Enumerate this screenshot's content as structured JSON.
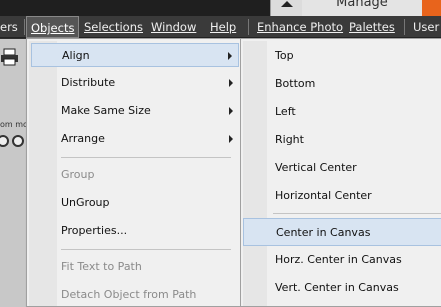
{
  "window": {
    "manage_tab": "Manage"
  },
  "menubar": {
    "items": [
      {
        "label": "ers"
      },
      {
        "label": "Objects"
      },
      {
        "label": "Selections"
      },
      {
        "label": "Window"
      },
      {
        "label": "Help"
      },
      {
        "label": "Enhance Photo"
      },
      {
        "label": "Palettes"
      },
      {
        "label": "User I"
      }
    ]
  },
  "toolbar": {
    "zoom_label": "om mo"
  },
  "objects_menu": {
    "items": [
      {
        "label": "Align",
        "submenu": true,
        "enabled": true,
        "highlighted": true
      },
      {
        "label": "Distribute",
        "submenu": true,
        "enabled": true
      },
      {
        "label": "Make Same Size",
        "submenu": true,
        "enabled": true
      },
      {
        "label": "Arrange",
        "submenu": true,
        "enabled": true
      },
      {
        "label": "Group",
        "enabled": false
      },
      {
        "label": "UnGroup",
        "enabled": true
      },
      {
        "label": "Properties...",
        "enabled": true
      },
      {
        "label": "Fit Text to Path",
        "enabled": false
      },
      {
        "label": "Detach Object from Path",
        "enabled": false
      }
    ]
  },
  "align_submenu": {
    "items": [
      {
        "label": "Top"
      },
      {
        "label": "Bottom"
      },
      {
        "label": "Left"
      },
      {
        "label": "Right"
      },
      {
        "label": "Vertical Center"
      },
      {
        "label": "Horizontal Center"
      },
      {
        "label": "Center in Canvas",
        "highlighted": true
      },
      {
        "label": "Horz. Center in Canvas"
      },
      {
        "label": "Vert. Center in Canvas"
      }
    ]
  },
  "colors": {
    "accent": "#e8641c",
    "menubar_bg": "#3a3a3a",
    "menu_bg": "#f0f0f0",
    "highlight_bg": "#d8e4f2"
  }
}
